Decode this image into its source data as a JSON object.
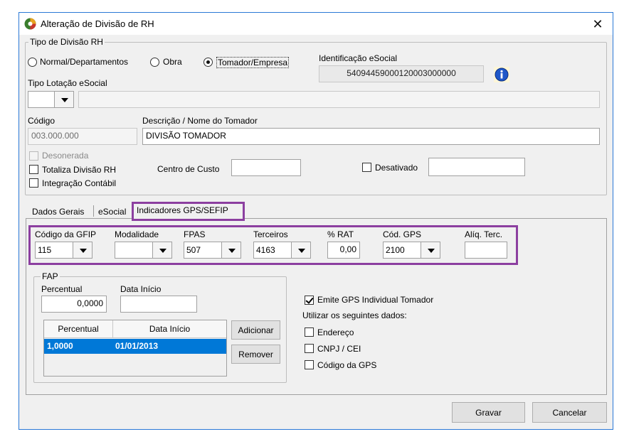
{
  "window": {
    "title": "Alteração de Divisão de RH",
    "close_glyph": "✕"
  },
  "tipo_divisao": {
    "legend": "Tipo de Divisão RH",
    "options": [
      "Normal/Departamentos",
      "Obra",
      "Tomador/Empresa"
    ],
    "selected": "Tomador/Empresa"
  },
  "identificacao": {
    "label": "Identificação eSocial",
    "value": "540944590001200030000​00"
  },
  "tipo_lotacao": {
    "label": "Tipo Lotação eSocial",
    "value": "",
    "desc": ""
  },
  "codigo": {
    "label": "Código",
    "value": "003.000.000"
  },
  "descricao": {
    "label": "Descrição / Nome do Tomador",
    "value": "DIVISÃO TOMADOR"
  },
  "checks": {
    "desonerada": {
      "label": "Desonerada",
      "checked": false,
      "disabled": true
    },
    "totaliza": {
      "label": "Totaliza Divisão RH",
      "checked": false
    },
    "integracao": {
      "label": "Integração Contábil",
      "checked": false
    },
    "desativado": {
      "label": "Desativado",
      "checked": false
    }
  },
  "centro_custo": {
    "label": "Centro de Custo",
    "value": ""
  },
  "desativado_value": "",
  "tabs": [
    "Dados Gerais",
    "eSocial",
    "Indicadores GPS/SEFIP"
  ],
  "active_tab": "Indicadores GPS/SEFIP",
  "gps": {
    "codigo_gfip": {
      "label": "Código da GFIP",
      "value": "115"
    },
    "modalidade": {
      "label": "Modalidade",
      "value": ""
    },
    "fpas": {
      "label": "FPAS",
      "value": "507"
    },
    "terceiros": {
      "label": "Terceiros",
      "value": "4163"
    },
    "rat": {
      "label": "% RAT",
      "value": "0,00"
    },
    "cod_gps": {
      "label": "Cód. GPS",
      "value": "2100"
    },
    "aliq_terc": {
      "label": "Alíq. Terc.",
      "value": ""
    }
  },
  "fap": {
    "legend": "FAP",
    "percentual_label": "Percentual",
    "percentual_value": "0,0000",
    "data_inicio_label": "Data Início",
    "data_inicio_value": "",
    "grid_headers": [
      "Percentual",
      "Data Início"
    ],
    "rows": [
      {
        "percentual": "1,0000",
        "data": "01/01/2013"
      }
    ],
    "add_label": "Adicionar",
    "remove_label": "Remover"
  },
  "emite": {
    "label": "Emite GPS Individual Tomador",
    "checked": true
  },
  "utilizar_label": "Utilizar os seguintes dados:",
  "dados": [
    {
      "label": "Endereço",
      "checked": false
    },
    {
      "label": "CNPJ / CEI",
      "checked": false
    },
    {
      "label": "Código da GPS",
      "checked": false
    }
  ],
  "footer": {
    "save": "Gravar",
    "cancel": "Cancelar"
  },
  "colors": {
    "accent": "#2b79d6",
    "highlight": "#8c3fa0",
    "selection": "#0078d7"
  }
}
